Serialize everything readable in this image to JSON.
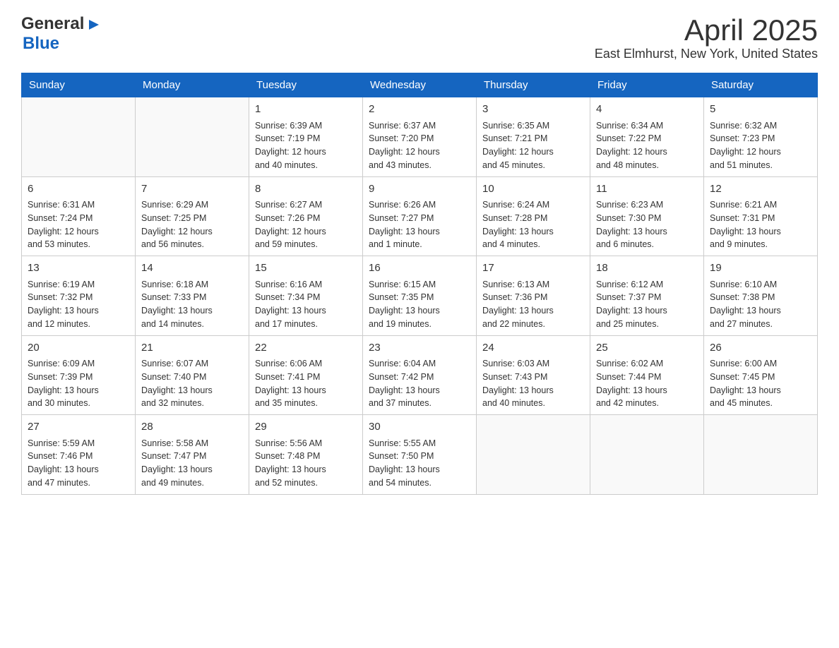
{
  "header": {
    "logo_general": "General",
    "logo_blue": "Blue",
    "month_title": "April 2025",
    "location": "East Elmhurst, New York, United States"
  },
  "calendar": {
    "days_of_week": [
      "Sunday",
      "Monday",
      "Tuesday",
      "Wednesday",
      "Thursday",
      "Friday",
      "Saturday"
    ],
    "weeks": [
      [
        {
          "day": "",
          "info": ""
        },
        {
          "day": "",
          "info": ""
        },
        {
          "day": "1",
          "info": "Sunrise: 6:39 AM\nSunset: 7:19 PM\nDaylight: 12 hours\nand 40 minutes."
        },
        {
          "day": "2",
          "info": "Sunrise: 6:37 AM\nSunset: 7:20 PM\nDaylight: 12 hours\nand 43 minutes."
        },
        {
          "day": "3",
          "info": "Sunrise: 6:35 AM\nSunset: 7:21 PM\nDaylight: 12 hours\nand 45 minutes."
        },
        {
          "day": "4",
          "info": "Sunrise: 6:34 AM\nSunset: 7:22 PM\nDaylight: 12 hours\nand 48 minutes."
        },
        {
          "day": "5",
          "info": "Sunrise: 6:32 AM\nSunset: 7:23 PM\nDaylight: 12 hours\nand 51 minutes."
        }
      ],
      [
        {
          "day": "6",
          "info": "Sunrise: 6:31 AM\nSunset: 7:24 PM\nDaylight: 12 hours\nand 53 minutes."
        },
        {
          "day": "7",
          "info": "Sunrise: 6:29 AM\nSunset: 7:25 PM\nDaylight: 12 hours\nand 56 minutes."
        },
        {
          "day": "8",
          "info": "Sunrise: 6:27 AM\nSunset: 7:26 PM\nDaylight: 12 hours\nand 59 minutes."
        },
        {
          "day": "9",
          "info": "Sunrise: 6:26 AM\nSunset: 7:27 PM\nDaylight: 13 hours\nand 1 minute."
        },
        {
          "day": "10",
          "info": "Sunrise: 6:24 AM\nSunset: 7:28 PM\nDaylight: 13 hours\nand 4 minutes."
        },
        {
          "day": "11",
          "info": "Sunrise: 6:23 AM\nSunset: 7:30 PM\nDaylight: 13 hours\nand 6 minutes."
        },
        {
          "day": "12",
          "info": "Sunrise: 6:21 AM\nSunset: 7:31 PM\nDaylight: 13 hours\nand 9 minutes."
        }
      ],
      [
        {
          "day": "13",
          "info": "Sunrise: 6:19 AM\nSunset: 7:32 PM\nDaylight: 13 hours\nand 12 minutes."
        },
        {
          "day": "14",
          "info": "Sunrise: 6:18 AM\nSunset: 7:33 PM\nDaylight: 13 hours\nand 14 minutes."
        },
        {
          "day": "15",
          "info": "Sunrise: 6:16 AM\nSunset: 7:34 PM\nDaylight: 13 hours\nand 17 minutes."
        },
        {
          "day": "16",
          "info": "Sunrise: 6:15 AM\nSunset: 7:35 PM\nDaylight: 13 hours\nand 19 minutes."
        },
        {
          "day": "17",
          "info": "Sunrise: 6:13 AM\nSunset: 7:36 PM\nDaylight: 13 hours\nand 22 minutes."
        },
        {
          "day": "18",
          "info": "Sunrise: 6:12 AM\nSunset: 7:37 PM\nDaylight: 13 hours\nand 25 minutes."
        },
        {
          "day": "19",
          "info": "Sunrise: 6:10 AM\nSunset: 7:38 PM\nDaylight: 13 hours\nand 27 minutes."
        }
      ],
      [
        {
          "day": "20",
          "info": "Sunrise: 6:09 AM\nSunset: 7:39 PM\nDaylight: 13 hours\nand 30 minutes."
        },
        {
          "day": "21",
          "info": "Sunrise: 6:07 AM\nSunset: 7:40 PM\nDaylight: 13 hours\nand 32 minutes."
        },
        {
          "day": "22",
          "info": "Sunrise: 6:06 AM\nSunset: 7:41 PM\nDaylight: 13 hours\nand 35 minutes."
        },
        {
          "day": "23",
          "info": "Sunrise: 6:04 AM\nSunset: 7:42 PM\nDaylight: 13 hours\nand 37 minutes."
        },
        {
          "day": "24",
          "info": "Sunrise: 6:03 AM\nSunset: 7:43 PM\nDaylight: 13 hours\nand 40 minutes."
        },
        {
          "day": "25",
          "info": "Sunrise: 6:02 AM\nSunset: 7:44 PM\nDaylight: 13 hours\nand 42 minutes."
        },
        {
          "day": "26",
          "info": "Sunrise: 6:00 AM\nSunset: 7:45 PM\nDaylight: 13 hours\nand 45 minutes."
        }
      ],
      [
        {
          "day": "27",
          "info": "Sunrise: 5:59 AM\nSunset: 7:46 PM\nDaylight: 13 hours\nand 47 minutes."
        },
        {
          "day": "28",
          "info": "Sunrise: 5:58 AM\nSunset: 7:47 PM\nDaylight: 13 hours\nand 49 minutes."
        },
        {
          "day": "29",
          "info": "Sunrise: 5:56 AM\nSunset: 7:48 PM\nDaylight: 13 hours\nand 52 minutes."
        },
        {
          "day": "30",
          "info": "Sunrise: 5:55 AM\nSunset: 7:50 PM\nDaylight: 13 hours\nand 54 minutes."
        },
        {
          "day": "",
          "info": ""
        },
        {
          "day": "",
          "info": ""
        },
        {
          "day": "",
          "info": ""
        }
      ]
    ]
  }
}
